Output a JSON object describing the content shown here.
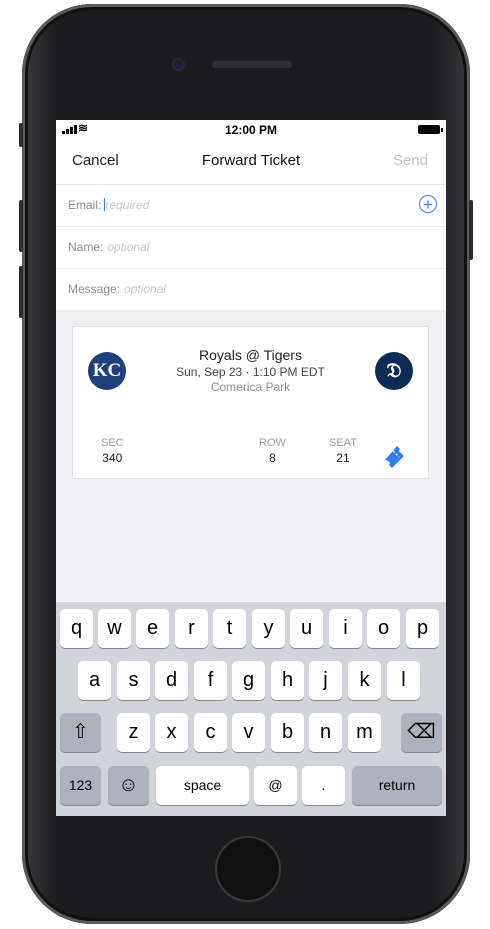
{
  "status_bar": {
    "time": "12:00 PM"
  },
  "nav": {
    "cancel_label": "Cancel",
    "title": "Forward Ticket",
    "send_label": "Send"
  },
  "form": {
    "email": {
      "label": "Email:",
      "placeholder": "required"
    },
    "name": {
      "label": "Name:",
      "placeholder": "optional"
    },
    "message": {
      "label": "Message:",
      "placeholder": "optional"
    }
  },
  "ticket": {
    "matchup": "Royals @ Tigers",
    "datetime": "Sun, Sep 23 · 1:10 PM EDT",
    "venue": "Comerica Park",
    "away_logo_text": "KC",
    "home_logo_text": "𝔇",
    "sec_label": "SEC",
    "sec_value": "340",
    "row_label": "ROW",
    "row_value": "8",
    "seat_label": "SEAT",
    "seat_value": "21"
  },
  "keyboard": {
    "row1": [
      "q",
      "w",
      "e",
      "r",
      "t",
      "y",
      "u",
      "i",
      "o",
      "p"
    ],
    "row2": [
      "a",
      "s",
      "d",
      "f",
      "g",
      "h",
      "j",
      "k",
      "l"
    ],
    "row3": [
      "z",
      "x",
      "c",
      "v",
      "b",
      "n",
      "m"
    ],
    "shift_icon": "⇧",
    "delete_icon": "⌫",
    "numbers_label": "123",
    "emoji_icon": "☺",
    "space_label": "space",
    "at_label": "@",
    "dot_label": ".",
    "return_label": "return"
  },
  "colors": {
    "accent": "#2f80ed",
    "royals": "#1d3f7a",
    "tigers": "#0c2c56"
  }
}
